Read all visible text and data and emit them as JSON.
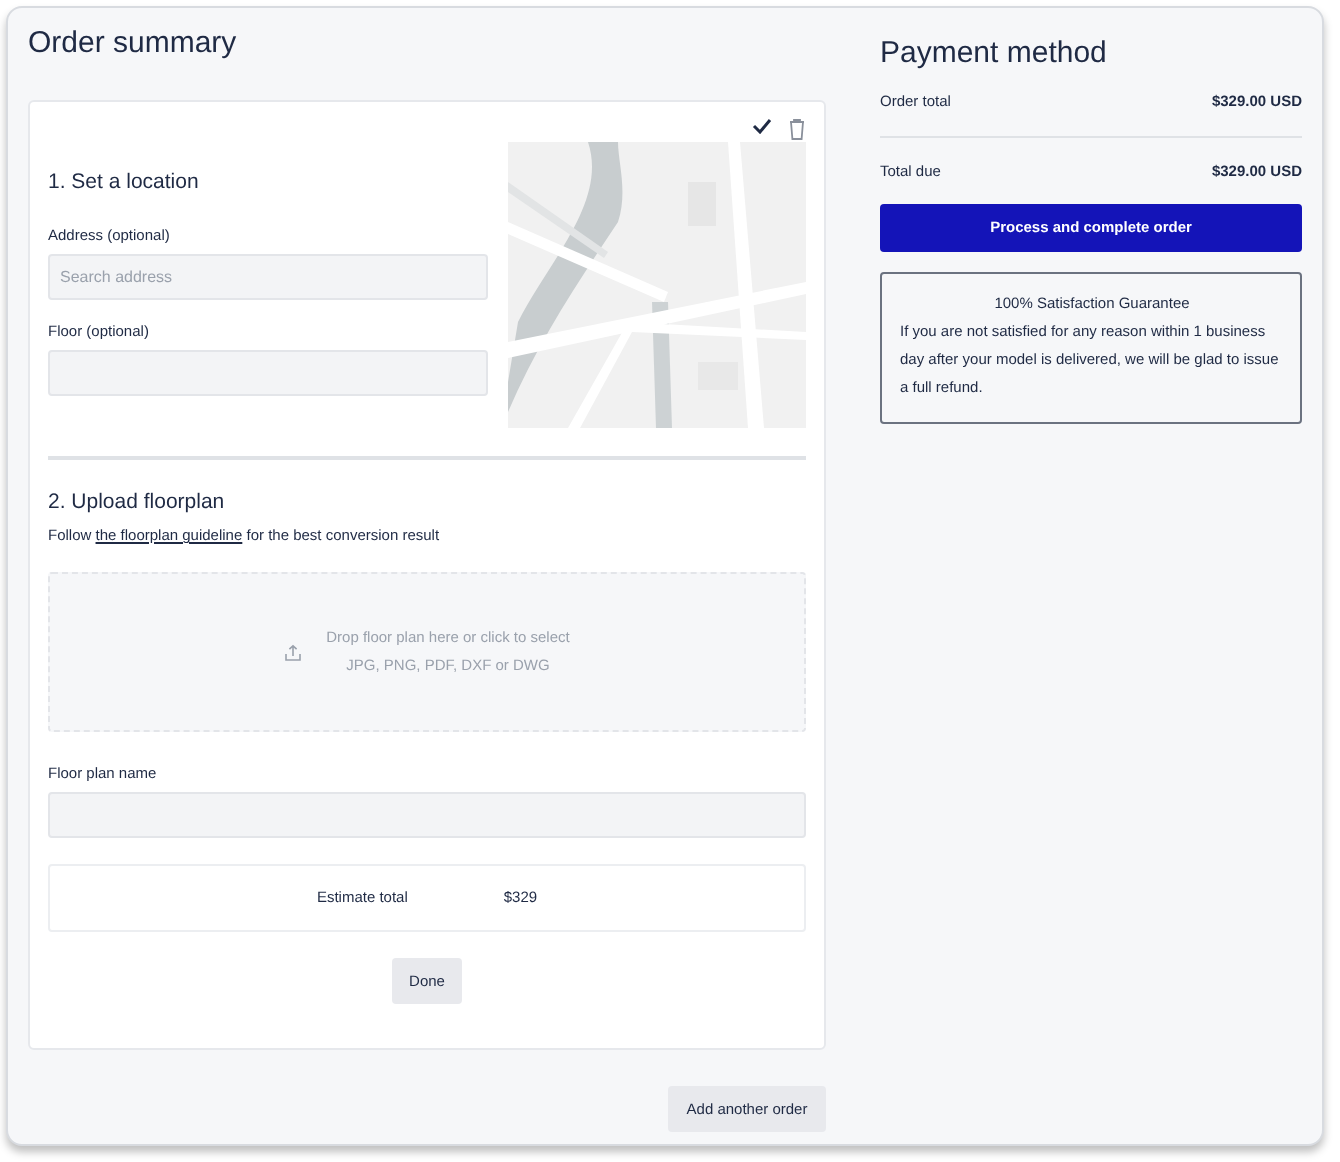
{
  "order_summary": {
    "title": "Order summary",
    "location": {
      "heading": "1. Set a location",
      "address": {
        "label": "Address (optional)",
        "placeholder": "Search address"
      },
      "floor": {
        "label": "Floor (optional)"
      }
    },
    "floorplan": {
      "heading": "2. Upload floorplan",
      "guide_before": "Follow ",
      "guide_link": "the floorplan guideline",
      "guide_after": " for the best conversion result",
      "dropzone": {
        "line1": "Drop floor plan here or click to select",
        "line2": "JPG, PNG, PDF, DXF or DWG"
      },
      "name_field": {
        "label": "Floor plan name"
      }
    },
    "estimate": {
      "label": "Estimate total",
      "value": "$329"
    },
    "done_button": "Done",
    "add_button": "Add another order"
  },
  "payment": {
    "title": "Payment method",
    "rows": [
      {
        "label": "Order total",
        "value": "$329.00 USD"
      },
      {
        "label": "Total due",
        "value": "$329.00 USD"
      }
    ],
    "submit_button": "Process and complete order",
    "guarantee": {
      "title": "100% Satisfaction Guarantee",
      "text": "If you are not satisfied for any reason within 1 business day after your model is delivered, we will be glad to issue a full refund."
    }
  }
}
